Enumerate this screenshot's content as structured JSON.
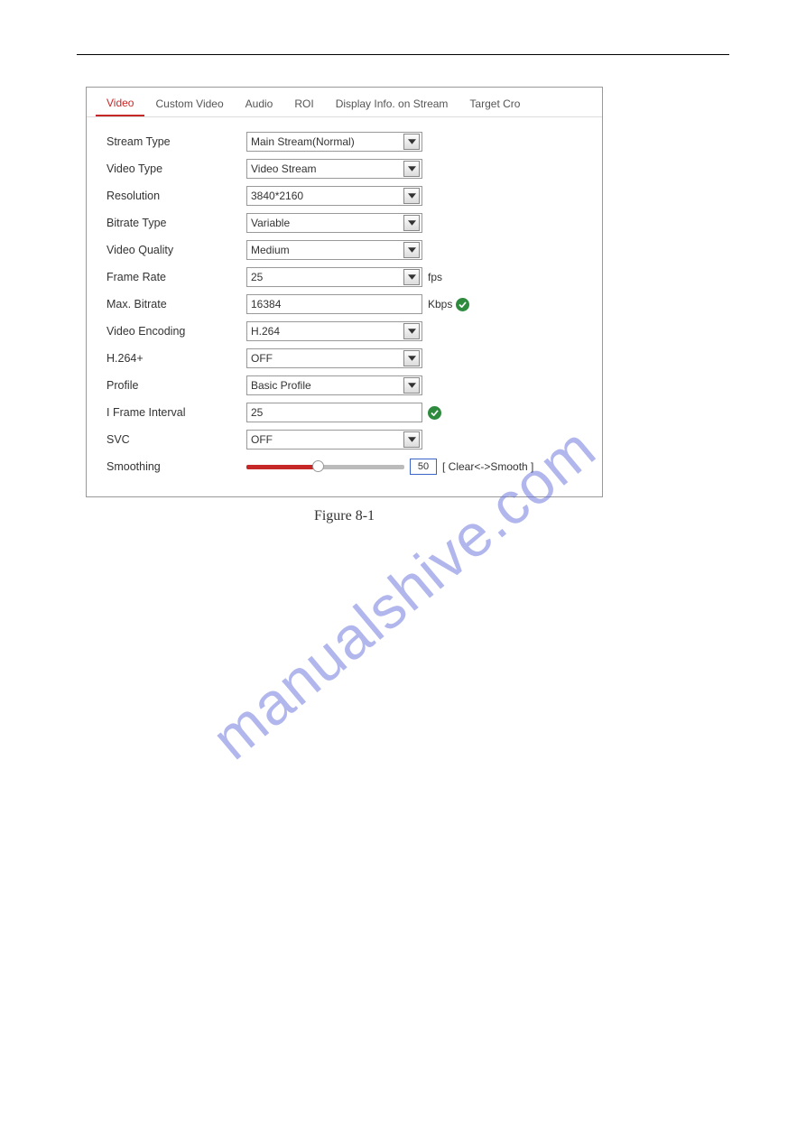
{
  "tabs": [
    "Video",
    "Custom Video",
    "Audio",
    "ROI",
    "Display Info. on Stream",
    "Target Cro"
  ],
  "active_tab_index": 0,
  "fields": {
    "stream_type": {
      "label": "Stream Type",
      "value": "Main Stream(Normal)",
      "kind": "select"
    },
    "video_type": {
      "label": "Video Type",
      "value": "Video Stream",
      "kind": "select"
    },
    "resolution": {
      "label": "Resolution",
      "value": "3840*2160",
      "kind": "select"
    },
    "bitrate_type": {
      "label": "Bitrate Type",
      "value": "Variable",
      "kind": "select"
    },
    "video_quality": {
      "label": "Video Quality",
      "value": "Medium",
      "kind": "select"
    },
    "frame_rate": {
      "label": "Frame Rate",
      "value": "25",
      "kind": "select",
      "suffix": "fps"
    },
    "max_bitrate": {
      "label": "Max. Bitrate",
      "value": "16384",
      "kind": "input",
      "suffix": "Kbps",
      "check": true
    },
    "video_encoding": {
      "label": "Video Encoding",
      "value": "H.264",
      "kind": "select"
    },
    "h264plus": {
      "label": "H.264+",
      "value": "OFF",
      "kind": "select"
    },
    "profile": {
      "label": "Profile",
      "value": "Basic Profile",
      "kind": "select"
    },
    "i_frame": {
      "label": "I Frame Interval",
      "value": "25",
      "kind": "input",
      "check": true
    },
    "svc": {
      "label": "SVC",
      "value": "OFF",
      "kind": "select"
    },
    "smoothing": {
      "label": "Smoothing",
      "value": "50",
      "kind": "slider",
      "hint": "[ Clear<->Smooth ]"
    }
  },
  "field_order": [
    "stream_type",
    "video_type",
    "resolution",
    "bitrate_type",
    "video_quality",
    "frame_rate",
    "max_bitrate",
    "video_encoding",
    "h264plus",
    "profile",
    "i_frame",
    "svc",
    "smoothing"
  ],
  "caption": "Figure 8-1",
  "watermark": "manualshive.com"
}
